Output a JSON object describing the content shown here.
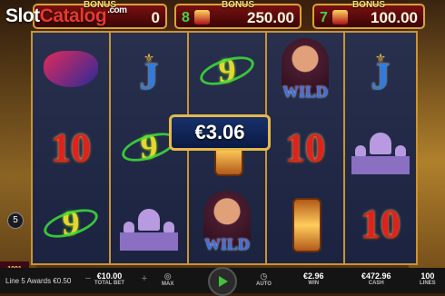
{
  "watermark": {
    "slot": "Slot",
    "catalog": "Catalog",
    "domain": ".com"
  },
  "bonus_meters": [
    {
      "label": "BONUS",
      "count": "",
      "amount": "0"
    },
    {
      "label": "BONUS",
      "count": "8",
      "amount": "250.00"
    },
    {
      "label": "BONUS",
      "count": "7",
      "amount": "100.00"
    }
  ],
  "wild_badge": "WILD",
  "reels": [
    [
      "mask",
      "10",
      "9"
    ],
    [
      "J",
      "9",
      "palace"
    ],
    [
      "9",
      "lantern",
      "wild"
    ],
    [
      "wild",
      "10",
      "lantern"
    ],
    [
      "J",
      "palace",
      "10"
    ]
  ],
  "symbols": {
    "ten": "10",
    "jack": "J",
    "nine": "9",
    "wild": "WILD"
  },
  "win_amount": "€3.06",
  "line_marker": "5",
  "logo_text": "1001 NIGHTS",
  "bottom_bar": {
    "message": "Line 5 Awards €0.50",
    "total_bet_value": "€10.00",
    "total_bet_label": "TOTAL BET",
    "max_label": "MAX",
    "auto_label": "AUTO",
    "win_value": "€2.96",
    "win_label": "WIN",
    "cash_value": "€472.96",
    "cash_label": "CASH",
    "lines_value": "100",
    "lines_label": "LINES"
  },
  "colors": {
    "frame": "#c99436",
    "win_green": "#43d24c",
    "ten_red": "#e0211c",
    "jack_blue": "#2f7be0"
  }
}
